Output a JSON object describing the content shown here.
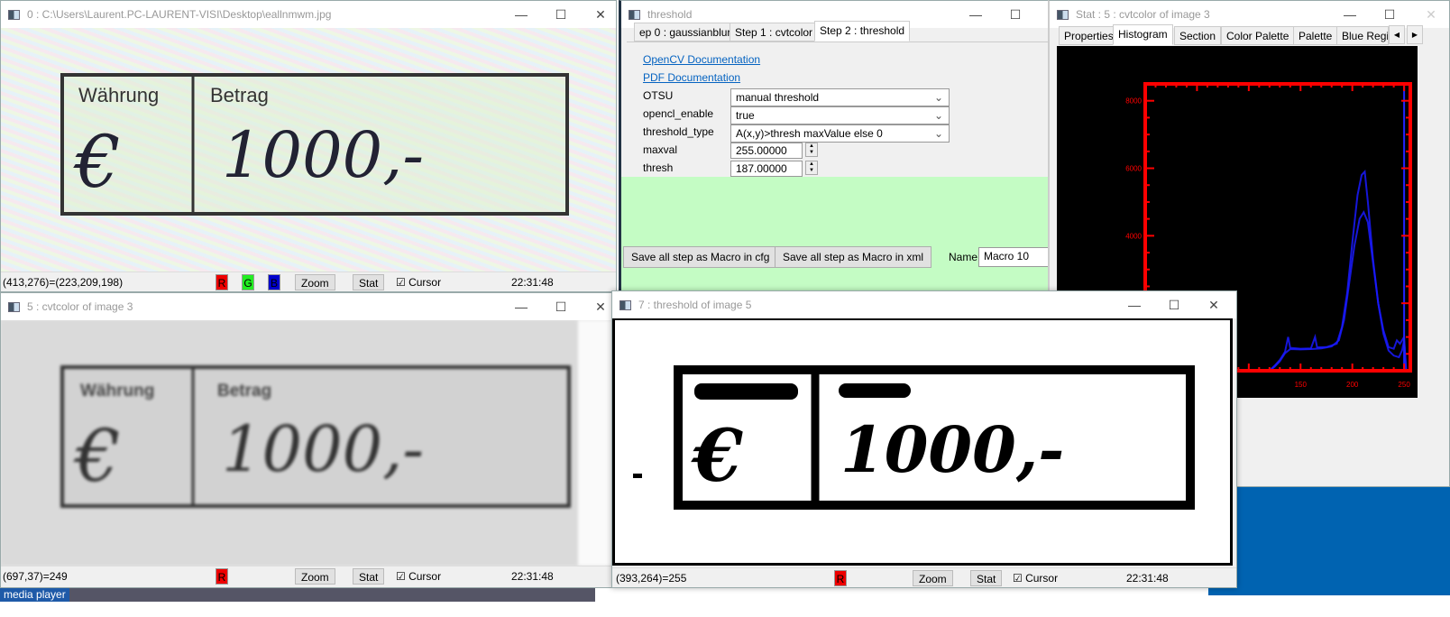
{
  "document_text": {
    "currency_label": "Währung",
    "amount_label": "Betrag",
    "euro_sign": "€",
    "amount": "1000,-"
  },
  "win0": {
    "title": "0 : C:\\Users\\Laurent.PC-LAURENT-VISI\\Desktop\\eallnmwm.jpg",
    "coord": "(413,276)=(223,209,198)",
    "r": "R",
    "g": "G",
    "b": "B",
    "zoom": "Zoom",
    "stat": "Stat",
    "cursor": "Cursor",
    "cursor_checked": true,
    "time": "22:31:48"
  },
  "threshold": {
    "title": "threshold",
    "tabs": [
      "ep 0 : gaussianblur",
      "Step 1 : cvtcolor",
      "Step 2 : threshold"
    ],
    "active_tab": 2,
    "opencv_doc": " OpenCV Documentation",
    "pdf_doc": "PDF Documentation",
    "params": [
      {
        "label": "OTSU",
        "value": "manual threshold"
      },
      {
        "label": "opencl_enable",
        "value": "true"
      },
      {
        "label": "threshold_type",
        "value": "A(x,y)>thresh maxValue else 0"
      },
      {
        "label": "maxval",
        "value": "255.00000"
      },
      {
        "label": "thresh",
        "value": "187.00000"
      }
    ],
    "save_cfg": "Save all step as Macro in cfg",
    "save_xml": "Save all step as Macro in xml",
    "name_label": "Name",
    "name_value": "Macro 10",
    "panel_color": "#c4fcc4"
  },
  "stat": {
    "title": "Stat : 5 : cvtcolor of image 3",
    "tabs": [
      "Properties",
      "Histogram",
      "Section",
      "Color Palette",
      "Palette",
      "Blue Regi"
    ],
    "active_tab": 1
  },
  "win5": {
    "title": "5 : cvtcolor of image 3",
    "coord": "(697,37)=249",
    "r": "R",
    "zoom": "Zoom",
    "stat": "Stat",
    "cursor": "Cursor",
    "cursor_checked": true,
    "time": "22:31:48"
  },
  "win7": {
    "title": "7 : threshold of image 5",
    "coord": "(393,264)=255",
    "r": "R",
    "zoom": "Zoom",
    "stat": "Stat",
    "cursor": "Cursor",
    "cursor_checked": true,
    "time": "22:31:48"
  },
  "taskbar": {
    "item": "media player"
  },
  "chart_data": {
    "type": "line",
    "xlim": [
      0,
      256
    ],
    "ylim": [
      0,
      8500
    ],
    "xticks": [
      150,
      200,
      250
    ],
    "yticks": [
      4000,
      6000,
      8000
    ],
    "axis_color": "#ff0000",
    "line_color": "#1a1aff",
    "background": "#000000",
    "marker_x": 250,
    "series": [
      {
        "values": [
          [
            0,
            0
          ],
          [
            120,
            0
          ],
          [
            125,
            150
          ],
          [
            130,
            320
          ],
          [
            135,
            560
          ],
          [
            138,
            1000
          ],
          [
            140,
            680
          ],
          [
            150,
            650
          ],
          [
            160,
            660
          ],
          [
            164,
            1000
          ],
          [
            166,
            690
          ],
          [
            175,
            700
          ],
          [
            185,
            800
          ],
          [
            190,
            1300
          ],
          [
            195,
            2300
          ],
          [
            200,
            3800
          ],
          [
            205,
            5200
          ],
          [
            209,
            5800
          ],
          [
            212,
            5900
          ],
          [
            215,
            5000
          ],
          [
            220,
            3300
          ],
          [
            225,
            2000
          ],
          [
            230,
            1200
          ],
          [
            235,
            700
          ],
          [
            240,
            650
          ],
          [
            243,
            900
          ],
          [
            246,
            800
          ],
          [
            250,
            1000
          ],
          [
            252,
            0
          ]
        ]
      },
      {
        "values": [
          [
            0,
            0
          ],
          [
            120,
            0
          ],
          [
            125,
            120
          ],
          [
            130,
            280
          ],
          [
            135,
            520
          ],
          [
            140,
            640
          ],
          [
            150,
            630
          ],
          [
            160,
            640
          ],
          [
            170,
            660
          ],
          [
            180,
            720
          ],
          [
            187,
            900
          ],
          [
            192,
            1500
          ],
          [
            197,
            2600
          ],
          [
            202,
            3700
          ],
          [
            207,
            4500
          ],
          [
            211,
            4700
          ],
          [
            215,
            4400
          ],
          [
            220,
            3200
          ],
          [
            225,
            2000
          ],
          [
            230,
            1100
          ],
          [
            235,
            600
          ],
          [
            240,
            450
          ],
          [
            245,
            400
          ],
          [
            248,
            600
          ],
          [
            250,
            900
          ],
          [
            252,
            0
          ]
        ]
      }
    ]
  }
}
